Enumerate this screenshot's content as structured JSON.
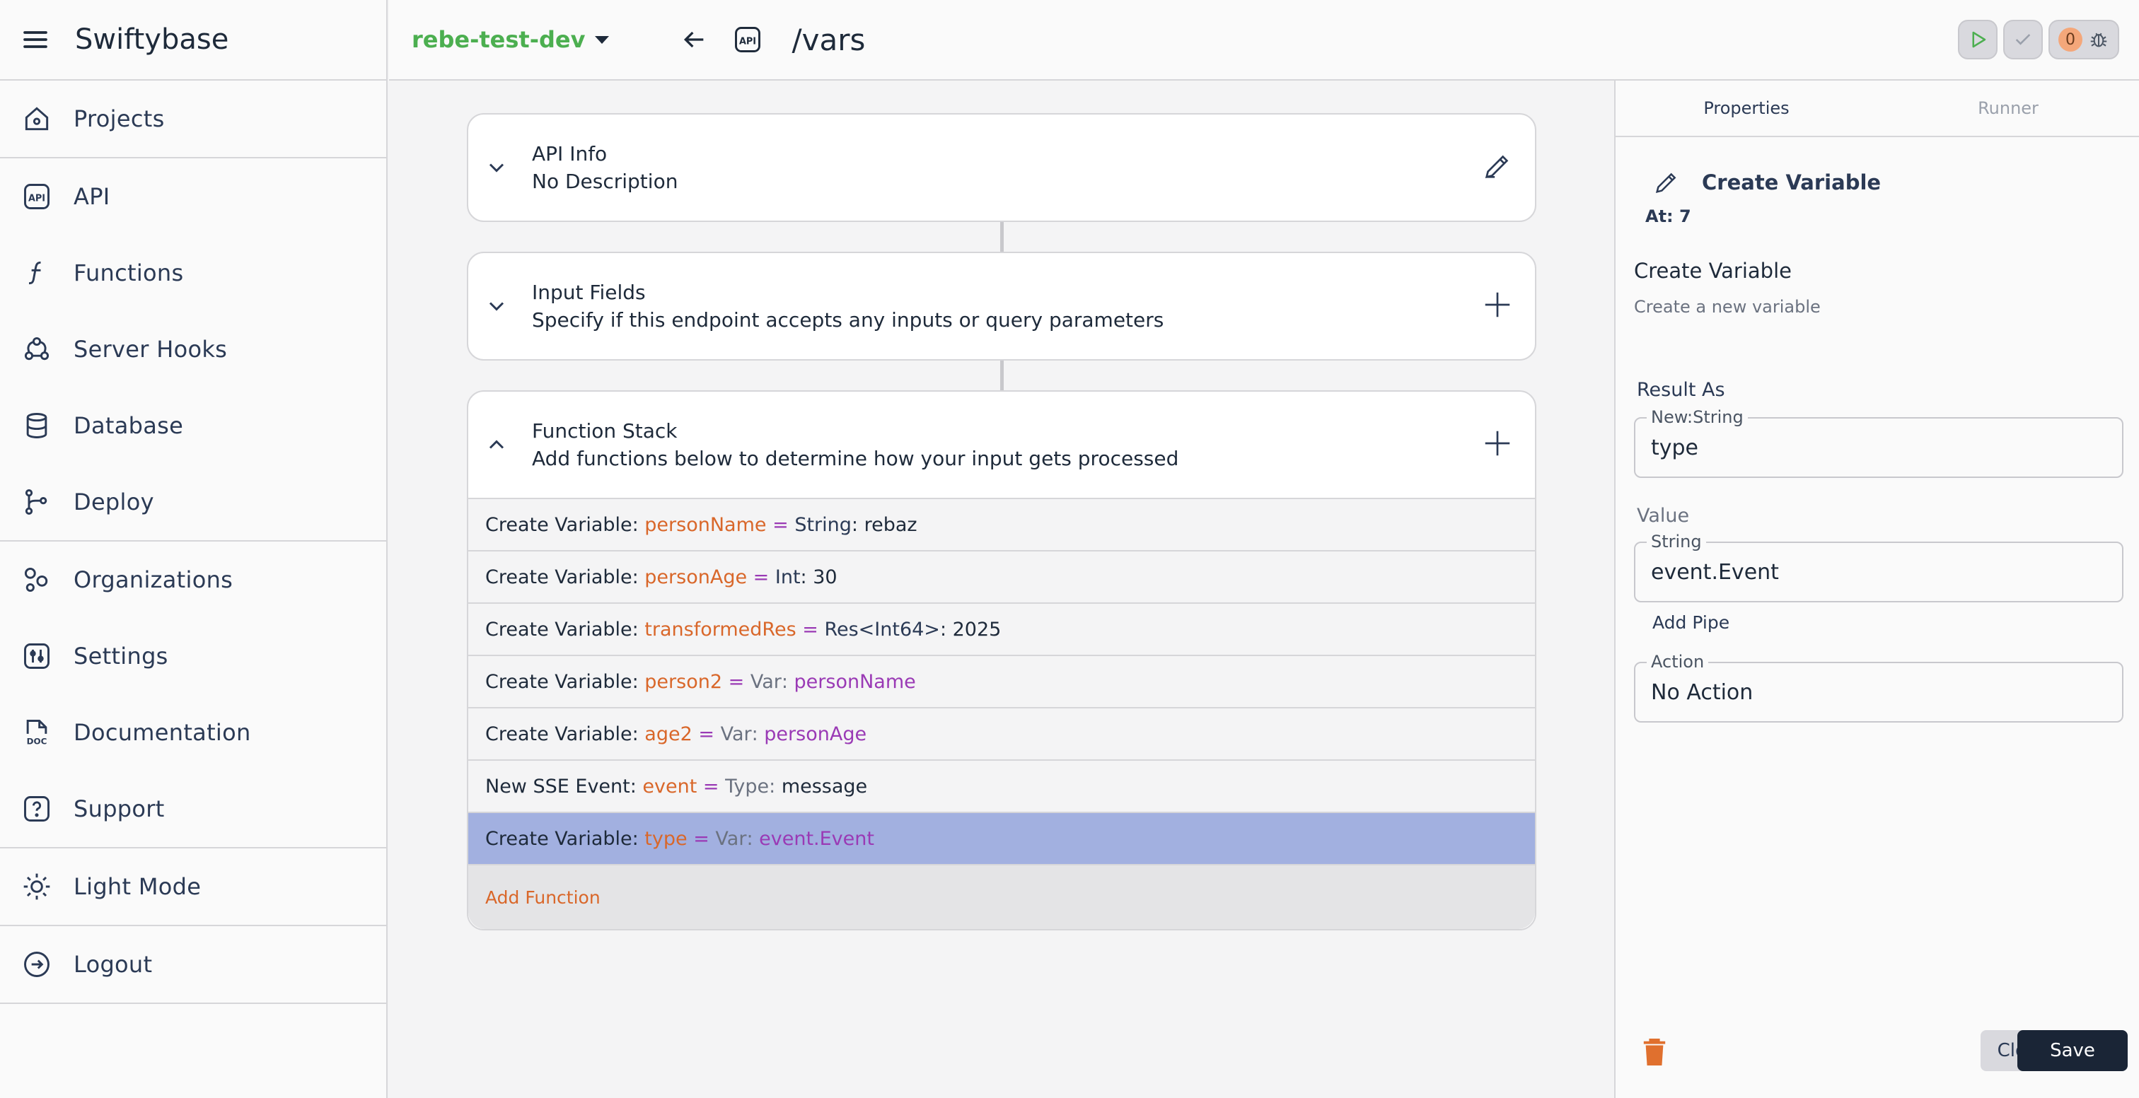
{
  "sidebar": {
    "brand": "Swiftybase",
    "items": [
      {
        "label": "Projects",
        "icon": "home-icon"
      },
      {
        "label": "API",
        "icon": "api-icon"
      },
      {
        "label": "Functions",
        "icon": "function-icon"
      },
      {
        "label": "Server Hooks",
        "icon": "webhook-icon"
      },
      {
        "label": "Database",
        "icon": "database-icon"
      },
      {
        "label": "Deploy",
        "icon": "git-branch-icon"
      },
      {
        "label": "Organizations",
        "icon": "organizations-icon"
      },
      {
        "label": "Settings",
        "icon": "settings-icon"
      },
      {
        "label": "Documentation",
        "icon": "doc-icon"
      },
      {
        "label": "Support",
        "icon": "help-icon"
      },
      {
        "label": "Light Mode",
        "icon": "sun-icon"
      },
      {
        "label": "Logout",
        "icon": "logout-icon"
      }
    ]
  },
  "topbar": {
    "project": "rebe-test-dev",
    "route": "/vars",
    "error_count": "0"
  },
  "main": {
    "api_info": {
      "title": "API Info",
      "subtitle": "No Description"
    },
    "input_fields": {
      "title": "Input Fields",
      "subtitle": "Specify if this endpoint accepts any inputs or query parameters"
    },
    "function_stack": {
      "title": "Function Stack",
      "subtitle": "Add functions below to determine how your input gets processed",
      "rows": [
        {
          "prefix": "Create Variable: ",
          "name": "personName",
          "eq": " = ",
          "type": "String",
          "sep": ": ",
          "value": "rebaz"
        },
        {
          "prefix": "Create Variable: ",
          "name": "personAge",
          "eq": " = ",
          "type": "Int",
          "sep": ": ",
          "value": "30"
        },
        {
          "prefix": "Create Variable: ",
          "name": "transformedRes",
          "eq": " = ",
          "type": "Res<Int64>",
          "sep": ": ",
          "value": "2025"
        },
        {
          "prefix": "Create Variable: ",
          "name": "person2",
          "eq": " = ",
          "type": "Var",
          "sep": ": ",
          "value": "personName"
        },
        {
          "prefix": "Create Variable: ",
          "name": "age2",
          "eq": " = ",
          "type": "Var",
          "sep": ": ",
          "value": "personAge"
        },
        {
          "prefix": "New SSE Event: ",
          "name": "event",
          "eq": " = ",
          "type": "Type",
          "sep": ": ",
          "value": "message"
        },
        {
          "prefix": "Create Variable: ",
          "name": "type",
          "eq": " = ",
          "type": "Var",
          "sep": ": ",
          "value": "event.Event"
        }
      ],
      "add_label": "Add Function"
    }
  },
  "panel": {
    "tabs": [
      "Properties",
      "Runner"
    ],
    "header_name": "Create Variable",
    "at": "At: 7",
    "title": "Create Variable",
    "description": "Create a new variable",
    "result_label": "Result As",
    "result_legend": "New:String",
    "result_value": "type",
    "value_label": "Value",
    "value_legend": "String",
    "value_value": "event.Event",
    "add_pipe": "Add Pipe",
    "action_legend": "Action",
    "action_value": "No Action",
    "close_label": "Close",
    "save_label": "Save"
  }
}
